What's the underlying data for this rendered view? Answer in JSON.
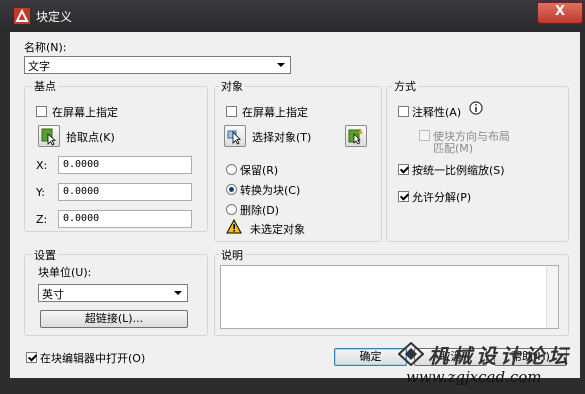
{
  "window": {
    "title": "块定义",
    "close_label": "X"
  },
  "name": {
    "label": "名称(N):",
    "value": "文字"
  },
  "base_point": {
    "title": "基点",
    "specify_on_screen": "在屏幕上指定",
    "pick_point": "拾取点(K)",
    "x_label": "X:",
    "x_value": "0.0000",
    "y_label": "Y:",
    "y_value": "0.0000",
    "z_label": "Z:",
    "z_value": "0.0000"
  },
  "objects": {
    "title": "对象",
    "specify_on_screen": "在屏幕上指定",
    "select_objects": "选择对象(T)",
    "retain": "保留(R)",
    "convert_to_block": "转换为块(C)",
    "delete": "删除(D)",
    "selected_option": "convert_to_block",
    "warning": "未选定对象"
  },
  "behavior": {
    "title": "方式",
    "annotative": "注释性(A)",
    "match_orientation_line1": "使块方向与布局",
    "match_orientation_line2": "匹配(M)",
    "scale_uniformly": "按统一比例缩放(S)",
    "allow_exploding": "允许分解(P)",
    "annotative_checked": false,
    "scale_uniformly_checked": true,
    "allow_exploding_checked": true
  },
  "settings": {
    "title": "设置",
    "block_unit_label": "块单位(U):",
    "block_unit_value": "英寸",
    "hyperlink": "超链接(L)..."
  },
  "description": {
    "title": "说明",
    "value": ""
  },
  "footer": {
    "open_in_editor": "在块编辑器中打开(O)",
    "open_in_editor_checked": true,
    "ok": "确定",
    "cancel": "取消",
    "help": "帮助(H)"
  },
  "watermark": {
    "line1": "机械设计论坛",
    "line2": "www.zgjxcad.com"
  },
  "colors": {
    "accent": "#1a3a7a",
    "title_bar": "#2d2d30",
    "close": "#c0392b",
    "warning": "#f5c400"
  }
}
